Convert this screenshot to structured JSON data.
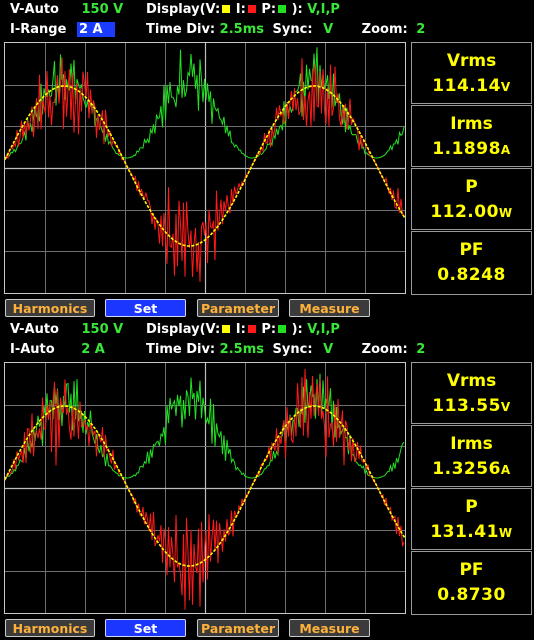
{
  "panels": [
    {
      "vrange_label": "V-Auto",
      "vrange_value": "150 V",
      "irange_label": "I-Range",
      "irange_value": "2 A",
      "display_label": "Display(",
      "v_key": "V:",
      "i_key": "I:",
      "p_key": "P:",
      "display_close": "):",
      "display_value": "V,I,P",
      "timediv_label": "Time Div:",
      "timediv_value": "2.5ms",
      "sync_label": "Sync:",
      "sync_value": "V",
      "zoom_label": "Zoom:",
      "zoom_value": "2",
      "measurements": [
        {
          "label": "Vrms",
          "value": "114.14",
          "unit": "V"
        },
        {
          "label": "Irms",
          "value": "1.1898",
          "unit": "A"
        },
        {
          "label": "P",
          "value": "112.00",
          "unit": "W"
        },
        {
          "label": "PF",
          "value": "0.8248",
          "unit": ""
        }
      ]
    },
    {
      "vrange_label": "V-Auto",
      "vrange_value": "150 V",
      "irange_label": "I-Auto",
      "irange_value": "2 A",
      "display_label": "Display(",
      "v_key": "V:",
      "i_key": "I:",
      "p_key": "P:",
      "display_close": "):",
      "display_value": "V,I,P",
      "timediv_label": "Time Div:",
      "timediv_value": "2.5ms",
      "sync_label": "Sync:",
      "sync_value": "V",
      "zoom_label": "Zoom:",
      "zoom_value": "2",
      "measurements": [
        {
          "label": "Vrms",
          "value": "113.55",
          "unit": "V"
        },
        {
          "label": "Irms",
          "value": "1.3256",
          "unit": "A"
        },
        {
          "label": "P",
          "value": "131.41",
          "unit": "W"
        },
        {
          "label": "PF",
          "value": "0.8730",
          "unit": ""
        }
      ]
    }
  ],
  "buttons": [
    {
      "label": "Harmonics",
      "active": false
    },
    {
      "label": "Set",
      "active": true
    },
    {
      "label": "Parameter",
      "active": false
    },
    {
      "label": "Measure",
      "active": false
    }
  ],
  "colors": {
    "voltage": "#ffff00",
    "current": "#ff1a1a",
    "power": "#22e022",
    "grid": "#7a7a7a",
    "button_active": "#1a36ff",
    "text_green": "#38e838"
  }
}
